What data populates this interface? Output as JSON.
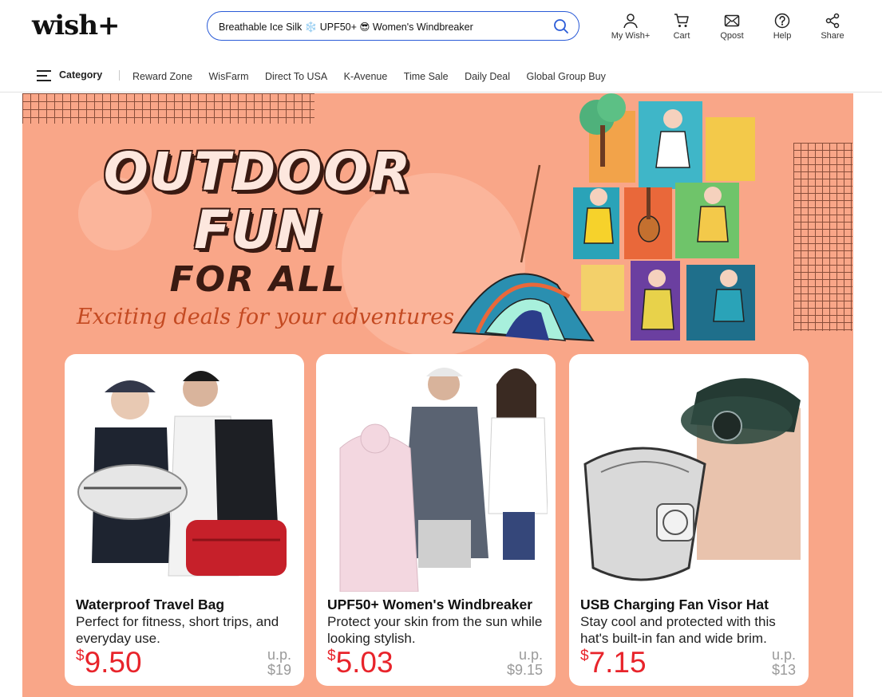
{
  "header": {
    "logo": "wish+",
    "search_value": "Breathable Ice Silk ❄️ UPF50+ 😎 Women's Windbreaker",
    "icons": [
      {
        "label": "My Wish+",
        "icon": "person-icon"
      },
      {
        "label": "Cart",
        "icon": "cart-icon"
      },
      {
        "label": "Qpost",
        "icon": "envelope-icon"
      },
      {
        "label": "Help",
        "icon": "help-icon"
      },
      {
        "label": "Share",
        "icon": "share-icon"
      }
    ]
  },
  "nav": {
    "category_label": "Category",
    "links": [
      "Reward Zone",
      "WisFarm",
      "Direct To USA",
      "K-Avenue",
      "Time Sale",
      "Daily Deal",
      "Global Group Buy"
    ]
  },
  "banner": {
    "line1": "OUTDOOR",
    "line2": "FUN",
    "line3": "FOR ALL",
    "tagline": "Exciting deals for your adventures",
    "background_color": "#f9a688"
  },
  "products": [
    {
      "title": "Waterproof Travel Bag",
      "description": "Perfect for fitness, short trips, and everyday use.",
      "currency": "$",
      "price": "9.50",
      "up_label": "u.p.",
      "up_price": "$19"
    },
    {
      "title": "UPF50+ Women's Windbreaker",
      "description": "Protect your skin from the sun while looking stylish.",
      "currency": "$",
      "price": "5.03",
      "up_label": "u.p.",
      "up_price": "$9.15"
    },
    {
      "title": "USB Charging Fan Visor Hat",
      "description": "Stay cool and protected with this hat's built-in fan and wide brim.",
      "currency": "$",
      "price": "7.15",
      "up_label": "u.p.",
      "up_price": "$13"
    }
  ],
  "colors": {
    "accent_blue": "#2a5bd7",
    "price_red": "#e8242b",
    "banner_text_dark": "#3a1a12"
  }
}
